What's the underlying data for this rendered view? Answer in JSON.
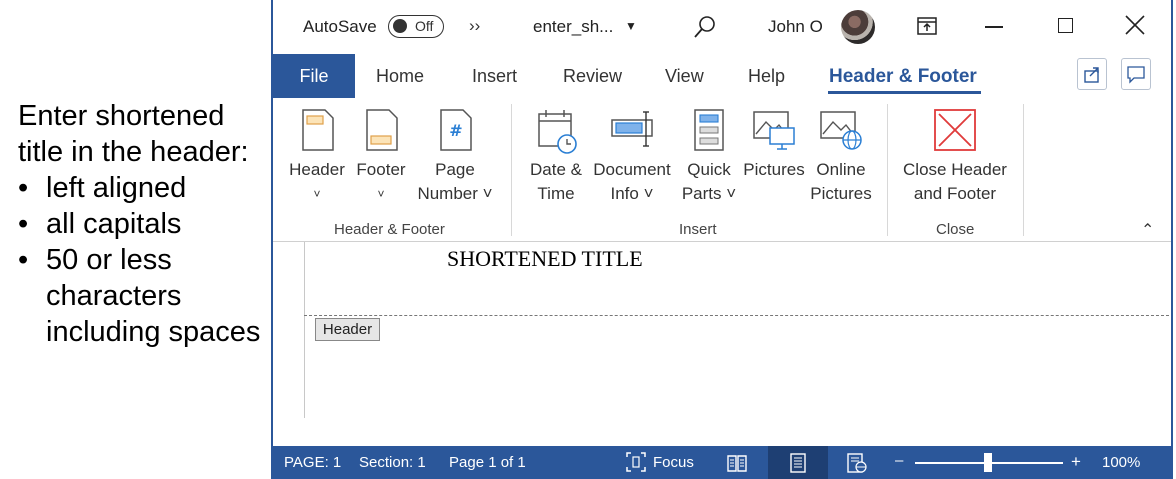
{
  "instructions": {
    "title": "Enter shortened title in the header:",
    "items": [
      "left aligned",
      "all capitals",
      "50 or less characters including spaces"
    ]
  },
  "titlebar": {
    "autosave": "AutoSave",
    "autosave_state": "Off",
    "more": "››",
    "doc_name": "enter_sh...",
    "user": "John O"
  },
  "tabs": {
    "file": "File",
    "items": [
      "Home",
      "Insert",
      "Review",
      "View",
      "Help"
    ],
    "active": "Header & Footer"
  },
  "ribbon": {
    "groups": {
      "header_footer": "Header & Footer",
      "insert": "Insert",
      "close": "Close"
    },
    "buttons": {
      "header": [
        "Header",
        "˅"
      ],
      "footer": [
        "Footer",
        "˅"
      ],
      "page_number": [
        "Page",
        "Number ˅"
      ],
      "date_time": [
        "Date &",
        "Time"
      ],
      "document_info": [
        "Document",
        "Info ˅"
      ],
      "quick_parts": [
        "Quick",
        "Parts ˅"
      ],
      "pictures": [
        "Pictures"
      ],
      "online_pictures": [
        "Online",
        "Pictures"
      ],
      "close_header_footer": [
        "Close Header",
        "and Footer"
      ]
    }
  },
  "document": {
    "header_text": "SHORTENED TITLE",
    "header_tag": "Header"
  },
  "statusbar": {
    "page": "PAGE: 1",
    "section": "Section: 1",
    "page_of": "Page 1 of 1",
    "focus": "Focus",
    "zoom_minus": "–",
    "zoom_plus": "+",
    "zoom": "100%"
  },
  "colors": {
    "accent": "#2b579a",
    "close_red": "#e03b3b"
  }
}
